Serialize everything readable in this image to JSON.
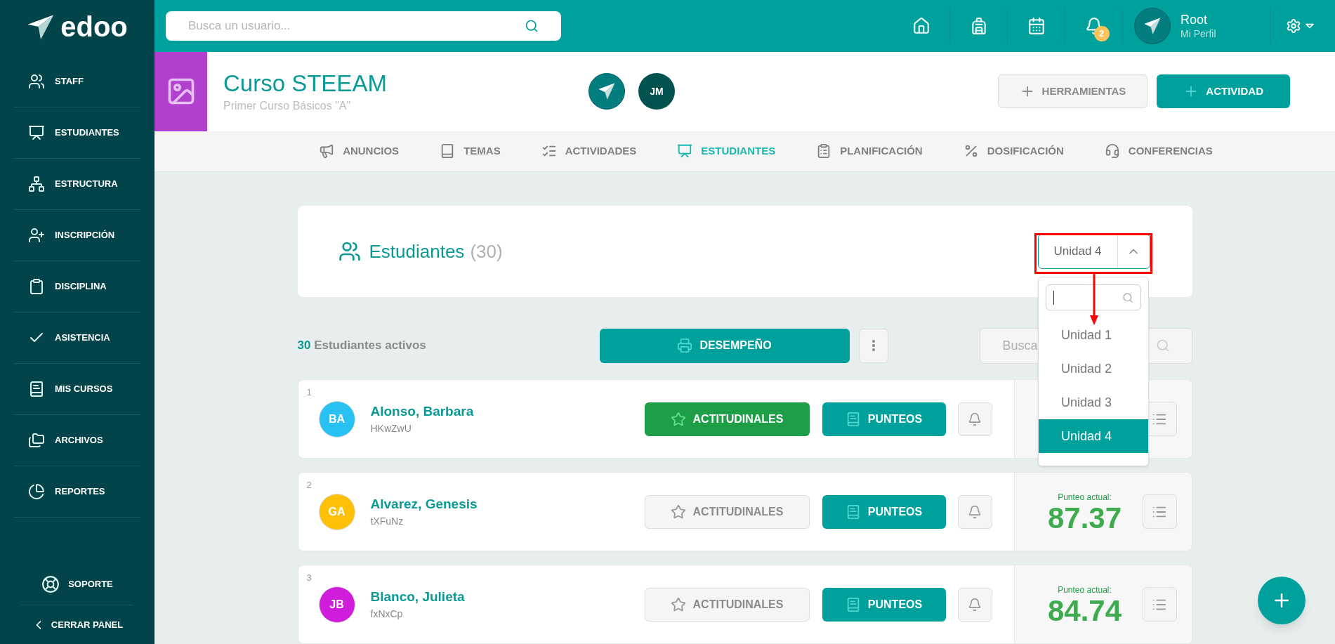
{
  "sidebar": {
    "logo": "edoo",
    "items": [
      {
        "kind": "staff",
        "label": "STAFF"
      },
      {
        "kind": "students",
        "label": "ESTUDIANTES"
      },
      {
        "kind": "structure",
        "label": "ESTRUCTURA"
      },
      {
        "kind": "enroll",
        "label": "INSCRIPCIÓN"
      },
      {
        "kind": "discipline",
        "label": "DISCIPLINA"
      },
      {
        "kind": "attendance",
        "label": "ASISTENCIA"
      },
      {
        "kind": "courses",
        "label": "MIS CURSOS"
      },
      {
        "kind": "files",
        "label": "ARCHIVOS"
      },
      {
        "kind": "reports",
        "label": "REPORTES"
      }
    ],
    "support": "SOPORTE",
    "collapse": "CERRAR PANEL"
  },
  "topbar": {
    "search_placeholder": "Busca un usuario...",
    "notifications": "2",
    "user": {
      "name": "Root",
      "link": "Mi Perfil"
    }
  },
  "course": {
    "title": "Curso STEEAM",
    "subtitle": "Primer Curso Básicos \"A\"",
    "member_initials": "JM",
    "buttons": [
      {
        "kind": "secondary",
        "label": "HERRAMIENTAS"
      },
      {
        "kind": "primary",
        "label": "ACTIVIDAD"
      }
    ]
  },
  "tabs": [
    {
      "kind": "announcements",
      "label": "ANUNCIOS",
      "selected": false
    },
    {
      "kind": "topics",
      "label": "TEMAS",
      "selected": false
    },
    {
      "kind": "activities",
      "label": "ACTIVIDADES",
      "selected": false
    },
    {
      "kind": "students",
      "label": "ESTUDIANTES",
      "selected": true
    },
    {
      "kind": "planning",
      "label": "PLANIFICACIÓN",
      "selected": false
    },
    {
      "kind": "dosage",
      "label": "DOSIFICACIÓN",
      "selected": false
    },
    {
      "kind": "conferences",
      "label": "CONFERENCIAS",
      "selected": false
    }
  ],
  "students_card": {
    "title": "Estudiantes",
    "count": "(30)",
    "unit_select": {
      "value": "Unidad 4",
      "options": [
        {
          "label": "Unidad 1",
          "selected": false
        },
        {
          "label": "Unidad 2",
          "selected": false
        },
        {
          "label": "Unidad 3",
          "selected": false
        },
        {
          "label": "Unidad 4",
          "selected": true
        }
      ]
    }
  },
  "toolbar": {
    "active_count": "30",
    "active_label": "Estudiantes activos",
    "report_button": "DESEMPEÑO",
    "search_placeholder": "Busca"
  },
  "students": [
    {
      "number": "1",
      "initials": "BA",
      "color": "#29c0f2",
      "name": "Alonso, Barbara",
      "code": "HKwZwU",
      "attitudinal_active": true,
      "attitudinal": "ACTITUDINALES",
      "scores": "PUNTEOS"
    },
    {
      "number": "2",
      "initials": "GA",
      "color": "#ffc107",
      "name": "Alvarez, Genesis",
      "code": "tXFuNz",
      "attitudinal_active": false,
      "attitudinal": "ACTITUDINALES",
      "scores": "PUNTEOS",
      "score_label": "Punteo actual:",
      "score": "87.37"
    },
    {
      "number": "3",
      "initials": "JB",
      "color": "#d01ddc",
      "name": "Blanco, Julieta",
      "code": "fxNxCp",
      "attitudinal_active": false,
      "attitudinal": "ACTITUDINALES",
      "scores": "PUNTEOS",
      "score_label": "Punteo actual:",
      "score": "84.74"
    }
  ]
}
